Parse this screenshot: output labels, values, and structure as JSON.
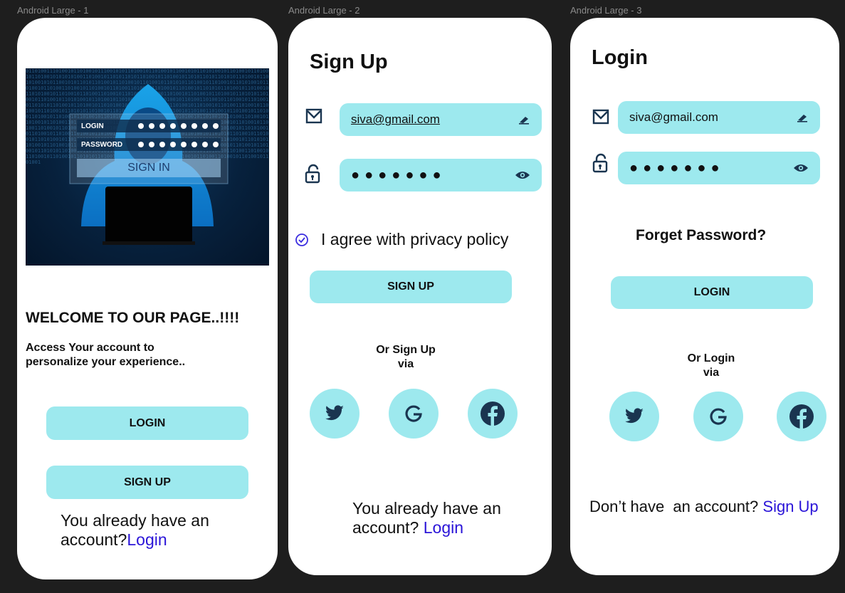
{
  "frames": [
    {
      "label": "Android Large - 1"
    },
    {
      "label": "Android Large - 2"
    },
    {
      "label": "Android Large - 3"
    }
  ],
  "welcome": {
    "hero_login_label": "LOGIN",
    "hero_password_label": "PASSWORD",
    "hero_signin_label": "SIGN IN",
    "heading": "WELCOME TO OUR PAGE..!!!!",
    "subtext_line1": "Access Your account to",
    "subtext_line2": "personalize your experience..",
    "login_button": "LOGIN",
    "signup_button": "SIGN UP",
    "footer_prefix_line1": "You already have an",
    "footer_prefix_line2": "account?",
    "footer_link": "Login"
  },
  "signup": {
    "title": "Sign Up",
    "email_value": "siva@gmail.com",
    "password_value": "●●●●●●●",
    "agree_text": "I agree with privacy policy",
    "signup_button": "SIGN UP",
    "or_line1": "Or Sign Up",
    "or_line2": "via",
    "footer_line1": "You already have an",
    "footer_prefix_line2": "account? ",
    "footer_link": "Login"
  },
  "login": {
    "title": "Login",
    "email_value": "siva@gmail.com",
    "password_value": "●●●●●●●",
    "forgot": "Forget Password?",
    "login_button": "LOGIN",
    "or_line1": "Or Login",
    "or_line2": "via",
    "footer_prefix": "Don’t have  an account? ",
    "footer_link": "Sign Up"
  },
  "icons": [
    "mail-icon",
    "lock-icon",
    "edit-icon",
    "eye-icon",
    "check-circle-icon",
    "twitter-icon",
    "google-icon",
    "facebook-icon"
  ],
  "colors": {
    "accent": "#9de9ee",
    "link": "#2a14d8",
    "canvas": "#1e1e1e",
    "icon": "#1a3550"
  }
}
